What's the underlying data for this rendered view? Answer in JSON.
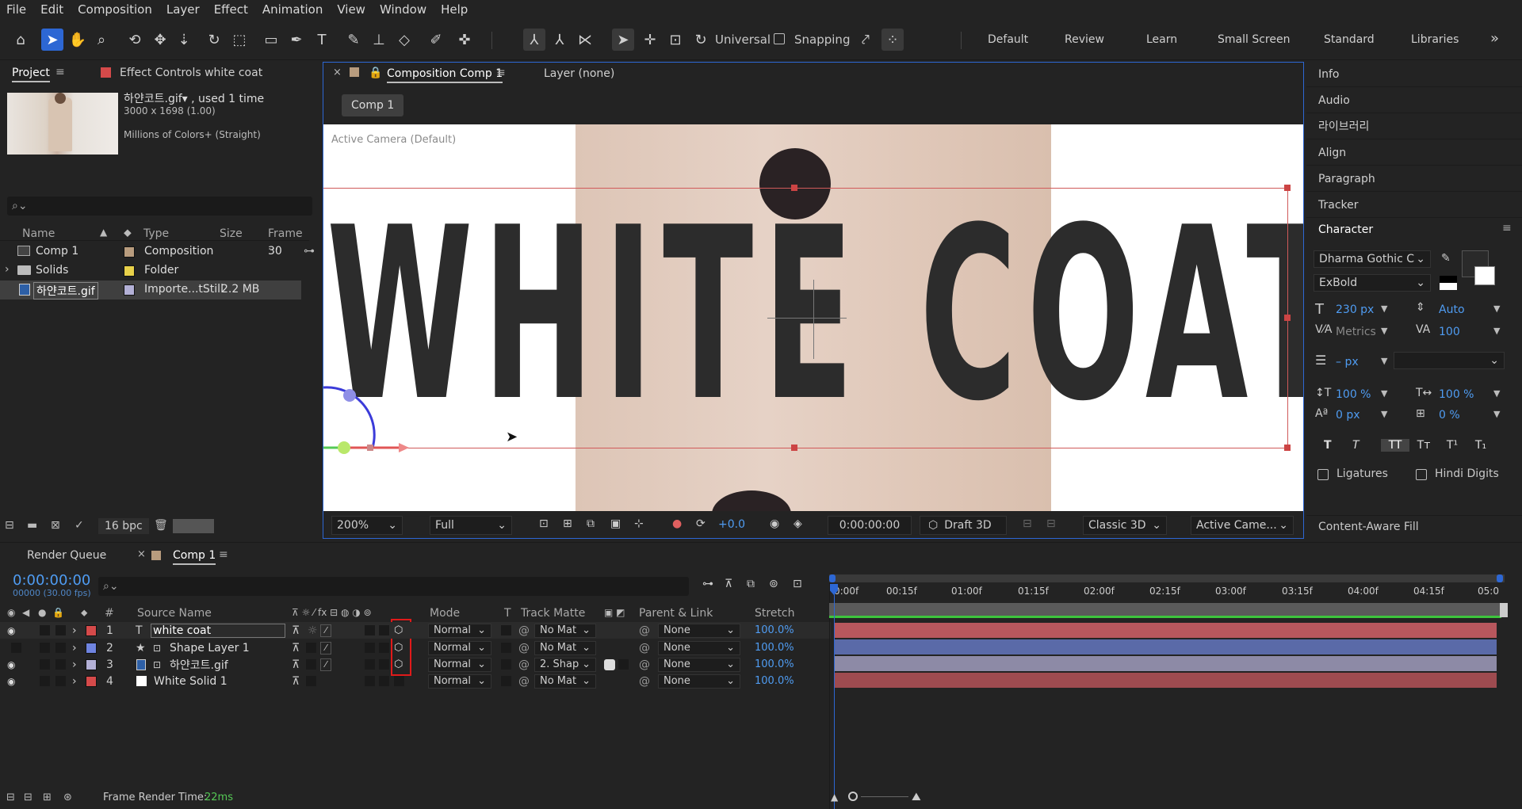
{
  "menu": [
    "File",
    "Edit",
    "Composition",
    "Layer",
    "Effect",
    "Animation",
    "View",
    "Window",
    "Help"
  ],
  "toolbar": {
    "universal_label": "Universal",
    "snapping_label": "Snapping",
    "workspaces": [
      "Default",
      "Review",
      "Learn",
      "Small Screen",
      "Standard",
      "Libraries"
    ],
    "overflow": "»"
  },
  "project": {
    "tab_label": "Project",
    "effect_controls_label": "Effect Controls white coat",
    "item_name": "하얀코트.gif▾ , used 1 time",
    "dimensions": "3000 x 1698 (1.00)",
    "colors": "Millions of Colors+ (Straight)",
    "search_placeholder": "⌕⌄",
    "columns": [
      "Name",
      "Type",
      "Size",
      "Frame ..."
    ],
    "items": [
      {
        "name": "Comp 1",
        "type": "Composition",
        "size": "30",
        "color": "#b89c7e"
      },
      {
        "name": "Solids",
        "type": "Folder",
        "size": "",
        "color": "#e8d14a"
      },
      {
        "name": "하얀코트.gif",
        "type": "Importe...tStill",
        "size": "2.2 MB",
        "color": "#b3b0d6"
      }
    ],
    "bpc": "16 bpc"
  },
  "composition": {
    "tab_label": "Composition Comp 1",
    "layer_label": "Layer (none)",
    "comp_chip": "Comp 1",
    "camera_label": "Active Camera (Default)",
    "canvas_text": "WHITE COAT",
    "zoom": "200%",
    "resolution": "Full",
    "exposure": "+0.0",
    "timecode": "0:00:00:00",
    "draft3d": "Draft 3D",
    "renderer": "Classic 3D",
    "view": "Active Came..."
  },
  "right_panels": {
    "items": [
      "Info",
      "Audio",
      "라이브러리",
      "Align",
      "Paragraph",
      "Tracker"
    ],
    "character_label": "Character",
    "font_family": "Dharma Gothic C",
    "font_style": "ExBold",
    "font_size": "230 px",
    "leading": "Auto",
    "kerning": "Metrics",
    "tracking": "100",
    "stroke_width": "– px",
    "vscale": "100 %",
    "hscale": "100 %",
    "baseline": "0 px",
    "tsume": "0 %",
    "style_buttons": [
      "T",
      "T",
      "TT",
      "Tт",
      "T¹",
      "T₁"
    ],
    "ligatures": "Ligatures",
    "hindi_digits": "Hindi Digits",
    "content_aware": "Content-Aware Fill"
  },
  "timeline": {
    "render_queue_label": "Render Queue",
    "comp_tab": "Comp 1",
    "timecode": "0:00:00:00",
    "fps": "00000 (30.00 fps)",
    "search_placeholder": "⌕⌄",
    "col_headers": {
      "num": "#",
      "source": "Source Name",
      "mode": "Mode",
      "t": "T",
      "track_matte": "Track Matte",
      "parent": "Parent & Link",
      "stretch": "Stretch"
    },
    "ruler": [
      "0:00f",
      "00:15f",
      "01:00f",
      "01:15f",
      "02:00f",
      "02:15f",
      "03:00f",
      "03:15f",
      "04:00f",
      "04:15f",
      "05:0"
    ],
    "layers": [
      {
        "num": "1",
        "name": "white coat",
        "kind": "T",
        "label_color": "#d54a4a",
        "mode": "Normal",
        "matte": "No Mat",
        "parent": "None",
        "stretch": "100.0%",
        "bar_color": "#b8575d"
      },
      {
        "num": "2",
        "name": "Shape Layer 1",
        "kind": "★",
        "label_color": "#6f84e0",
        "mode": "Normal",
        "matte": "No Mat",
        "parent": "None",
        "stretch": "100.0%",
        "bar_color": "#5a6aa8"
      },
      {
        "num": "3",
        "name": "하얀코트.gif",
        "kind": "img",
        "label_color": "#b3b0d6",
        "mode": "Normal",
        "matte": "2. Shap",
        "parent": "None",
        "stretch": "100.0%",
        "bar_color": "#8d8aa6"
      },
      {
        "num": "4",
        "name": "White Solid 1",
        "kind": "solid",
        "label_color": "#d54a4a",
        "mode": "Normal",
        "matte": "No Mat",
        "parent": "None",
        "stretch": "100.0%",
        "bar_color": "#9e4b50"
      }
    ],
    "frame_render_label": "Frame Render Time:",
    "frame_render_value": "22ms"
  }
}
